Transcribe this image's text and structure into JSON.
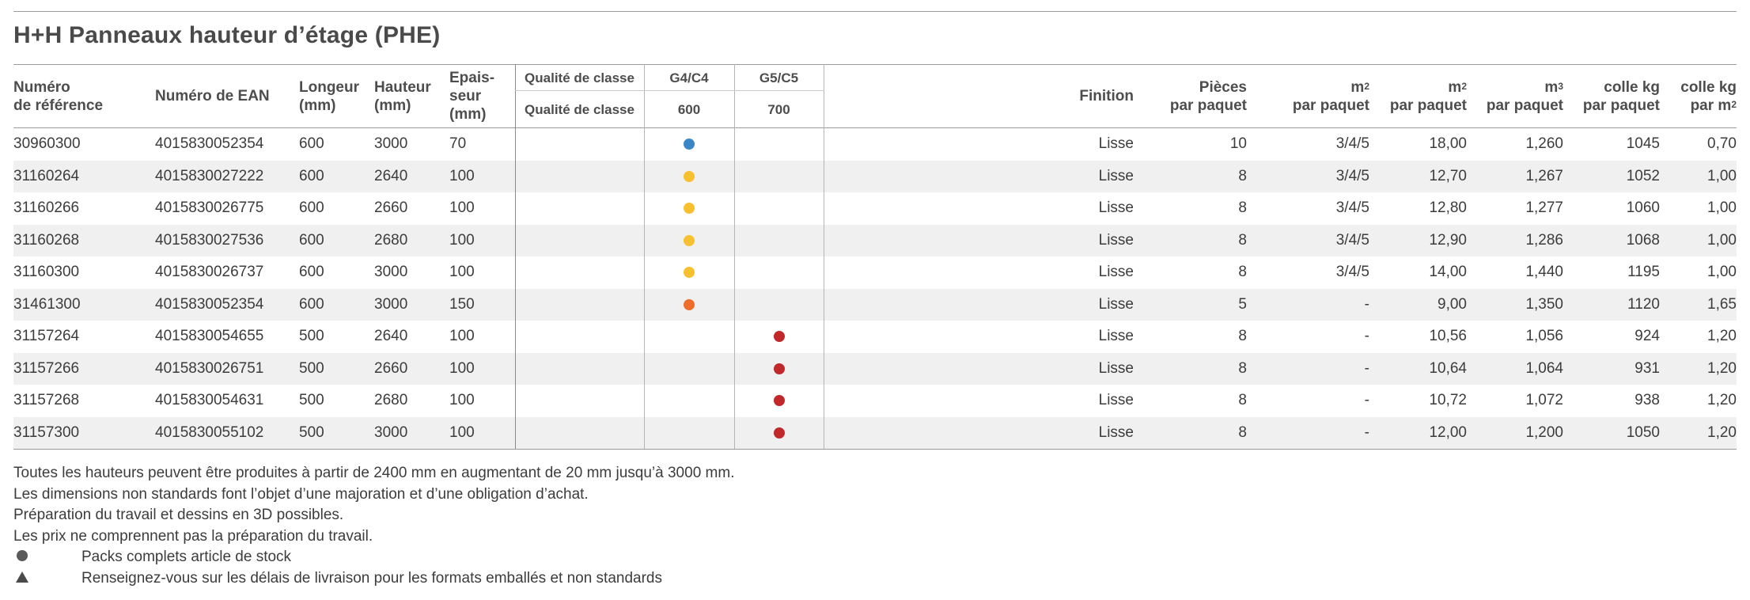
{
  "title": "H+H Panneaux hauteur d’étage (PHE)",
  "headers": {
    "ref": [
      "Numéro",
      "de référence"
    ],
    "ean": "Numéro de EAN",
    "longueur": [
      "Longeur",
      "(mm)"
    ],
    "hauteur": [
      "Hauteur",
      "(mm)"
    ],
    "epaisseur": [
      "Epais-",
      "seur",
      "(mm)"
    ],
    "qualite_top": "Qualité de classe",
    "qualite_bottom": "Qualité de classe",
    "g4_top": "G4/C4",
    "g4_bottom": "600",
    "g5_top": "G5/C5",
    "g5_bottom": "700",
    "finition": "Finition",
    "pieces": [
      "Pièces",
      "par paquet"
    ],
    "m2_paquet_1": [
      "m",
      "2"
    ],
    "m2_paquet_label": "par paquet",
    "m2_1": [
      "m",
      "2"
    ],
    "m2_label": "par paquet",
    "m3": [
      "m",
      "3"
    ],
    "m3_label": "par paquet",
    "kg_paquet": [
      "colle kg",
      "par paquet"
    ],
    "kg_m2": [
      "colle kg",
      "par m",
      "2"
    ]
  },
  "colors": {
    "blue": "#3a87c8",
    "yellow": "#f6c02e",
    "orange": "#ee6d2a",
    "red": "#c0282a"
  },
  "rows": [
    {
      "ref": "30960300",
      "ean": "4015830052354",
      "len": "600",
      "hau": "3000",
      "epa": "70",
      "dot_col": "g4",
      "dot": "blue",
      "fin": "Lisse",
      "pie": "10",
      "m2p": "3/4/5",
      "m2": "18,00",
      "m3": "1,260",
      "kg": "1045",
      "kgm": "0,70"
    },
    {
      "ref": "31160264",
      "ean": "4015830027222",
      "len": "600",
      "hau": "2640",
      "epa": "100",
      "dot_col": "g4",
      "dot": "yellow",
      "fin": "Lisse",
      "pie": "8",
      "m2p": "3/4/5",
      "m2": "12,70",
      "m3": "1,267",
      "kg": "1052",
      "kgm": "1,00"
    },
    {
      "ref": "31160266",
      "ean": "4015830026775",
      "len": "600",
      "hau": "2660",
      "epa": "100",
      "dot_col": "g4",
      "dot": "yellow",
      "fin": "Lisse",
      "pie": "8",
      "m2p": "3/4/5",
      "m2": "12,80",
      "m3": "1,277",
      "kg": "1060",
      "kgm": "1,00"
    },
    {
      "ref": "31160268",
      "ean": "4015830027536",
      "len": "600",
      "hau": "2680",
      "epa": "100",
      "dot_col": "g4",
      "dot": "yellow",
      "fin": "Lisse",
      "pie": "8",
      "m2p": "3/4/5",
      "m2": "12,90",
      "m3": "1,286",
      "kg": "1068",
      "kgm": "1,00"
    },
    {
      "ref": "31160300",
      "ean": "4015830026737",
      "len": "600",
      "hau": "3000",
      "epa": "100",
      "dot_col": "g4",
      "dot": "yellow",
      "fin": "Lisse",
      "pie": "8",
      "m2p": "3/4/5",
      "m2": "14,00",
      "m3": "1,440",
      "kg": "1195",
      "kgm": "1,00"
    },
    {
      "ref": "31461300",
      "ean": "4015830052354",
      "len": "600",
      "hau": "3000",
      "epa": "150",
      "dot_col": "g4",
      "dot": "orange",
      "fin": "Lisse",
      "pie": "5",
      "m2p": "-",
      "m2": "9,00",
      "m3": "1,350",
      "kg": "1120",
      "kgm": "1,65"
    },
    {
      "ref": "31157264",
      "ean": "4015830054655",
      "len": "500",
      "hau": "2640",
      "epa": "100",
      "dot_col": "g5",
      "dot": "red",
      "fin": "Lisse",
      "pie": "8",
      "m2p": "-",
      "m2": "10,56",
      "m3": "1,056",
      "kg": "924",
      "kgm": "1,20"
    },
    {
      "ref": "31157266",
      "ean": "4015830026751",
      "len": "500",
      "hau": "2660",
      "epa": "100",
      "dot_col": "g5",
      "dot": "red",
      "fin": "Lisse",
      "pie": "8",
      "m2p": "-",
      "m2": "10,64",
      "m3": "1,064",
      "kg": "931",
      "kgm": "1,20"
    },
    {
      "ref": "31157268",
      "ean": "4015830054631",
      "len": "500",
      "hau": "2680",
      "epa": "100",
      "dot_col": "g5",
      "dot": "red",
      "fin": "Lisse",
      "pie": "8",
      "m2p": "-",
      "m2": "10,72",
      "m3": "1,072",
      "kg": "938",
      "kgm": "1,20"
    },
    {
      "ref": "31157300",
      "ean": "4015830055102",
      "len": "500",
      "hau": "3000",
      "epa": "100",
      "dot_col": "g5",
      "dot": "red",
      "fin": "Lisse",
      "pie": "8",
      "m2p": "-",
      "m2": "12,00",
      "m3": "1,200",
      "kg": "1050",
      "kgm": "1,20"
    }
  ],
  "notes": [
    "Toutes les hauteurs peuvent être produites à partir de 2400 mm en augmentant de 20 mm jusqu’à 3000 mm.",
    "Les dimensions non standards font l’objet d’une majoration et d’une obligation d’achat.",
    "Préparation du travail et dessins en 3D possibles.",
    "Les prix ne comprennent pas la préparation du travail."
  ],
  "legend": [
    {
      "icon": "filled-circle-icon",
      "text": "Packs complets article de stock"
    },
    {
      "icon": "triangle-icon",
      "text": "Renseignez-vous sur les délais de livraison pour les formats emballés et non standards"
    }
  ]
}
